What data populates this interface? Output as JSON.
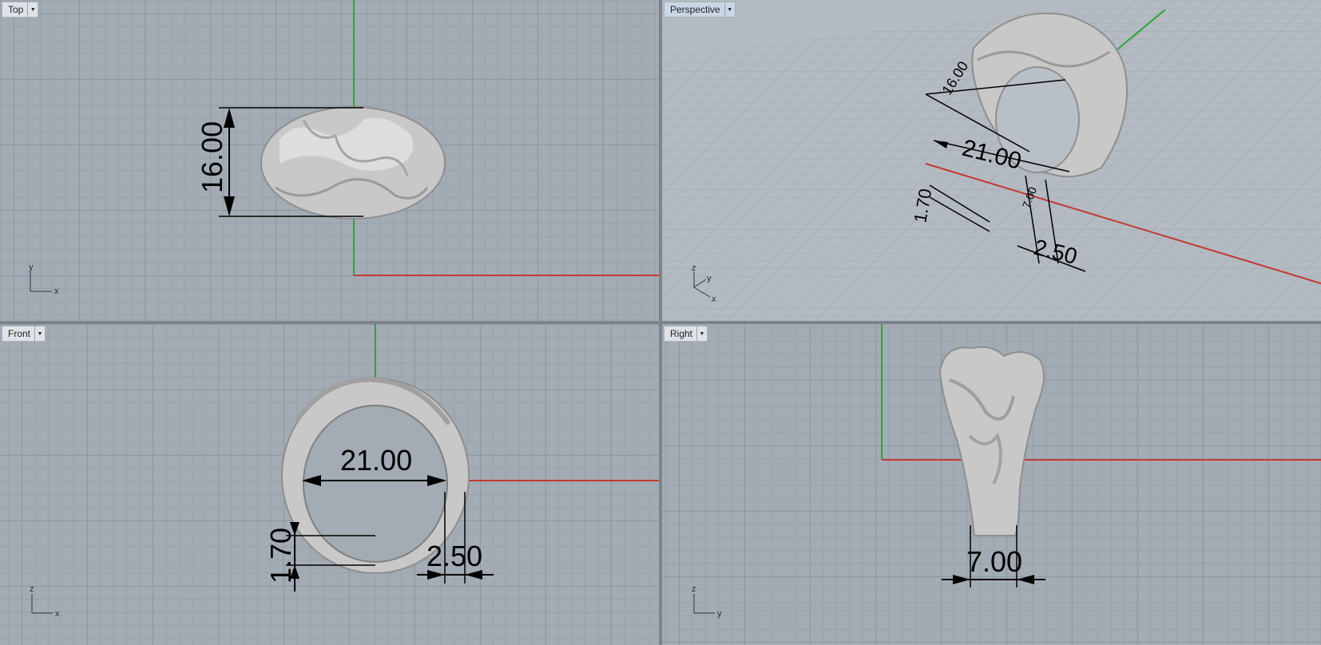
{
  "viewports": {
    "top": {
      "label": "Top",
      "dims": [
        "16.00"
      ],
      "axes": [
        "y",
        "x"
      ]
    },
    "perspective": {
      "label": "Perspective",
      "dims": [
        "16.00",
        "21.00",
        "1.70",
        "7.00",
        "2.50"
      ],
      "axes": [
        "z",
        "y",
        "x"
      ]
    },
    "front": {
      "label": "Front",
      "dims": [
        "21.00",
        "1.70",
        "2.50"
      ],
      "axes": [
        "z",
        "x"
      ]
    },
    "right": {
      "label": "Right",
      "dims": [
        "7.00"
      ],
      "axes": [
        "z",
        "y"
      ]
    }
  },
  "colors": {
    "x_axis": "#c33a33",
    "y_axis": "#2fa33a",
    "grid_bg": "#a3abb5",
    "ring": "#c9c9c9",
    "active_tab": "#c9d6e6"
  }
}
